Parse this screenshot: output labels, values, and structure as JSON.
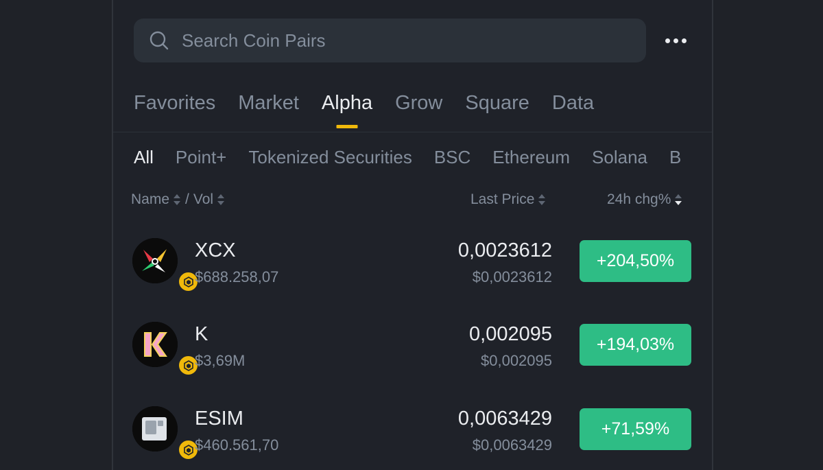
{
  "search": {
    "placeholder": "Search Coin Pairs"
  },
  "tabs": [
    {
      "label": "Favorites",
      "active": false
    },
    {
      "label": "Market",
      "active": false
    },
    {
      "label": "Alpha",
      "active": true
    },
    {
      "label": "Grow",
      "active": false
    },
    {
      "label": "Square",
      "active": false
    },
    {
      "label": "Data",
      "active": false
    }
  ],
  "subtabs": [
    {
      "label": "All",
      "active": true
    },
    {
      "label": "Point+"
    },
    {
      "label": "Tokenized Securities"
    },
    {
      "label": "BSC"
    },
    {
      "label": "Ethereum"
    },
    {
      "label": "Solana"
    },
    {
      "label": "B"
    }
  ],
  "columns": {
    "name": "Name",
    "separator": "/",
    "vol": "Vol",
    "last_price": "Last Price",
    "change": "24h chg%"
  },
  "rows": [
    {
      "symbol": "XCX",
      "volume": "$688.258,07",
      "price": "0,0023612",
      "usd_price": "$0,0023612",
      "change": "+204,50%",
      "icon": "xcx-token-icon"
    },
    {
      "symbol": "K",
      "volume": "$3,69M",
      "price": "0,002095",
      "usd_price": "$0,002095",
      "change": "+194,03%",
      "icon": "k-token-icon"
    },
    {
      "symbol": "ESIM",
      "volume": "$460.561,70",
      "price": "0,0063429",
      "usd_price": "$0,0063429",
      "change": "+71,59%",
      "icon": "esim-token-icon"
    }
  ],
  "colors": {
    "background": "#1f2229",
    "accent": "#f0b90b",
    "positive": "#2ebd85",
    "muted_text": "#848e9c",
    "primary_text": "#eaecef"
  }
}
